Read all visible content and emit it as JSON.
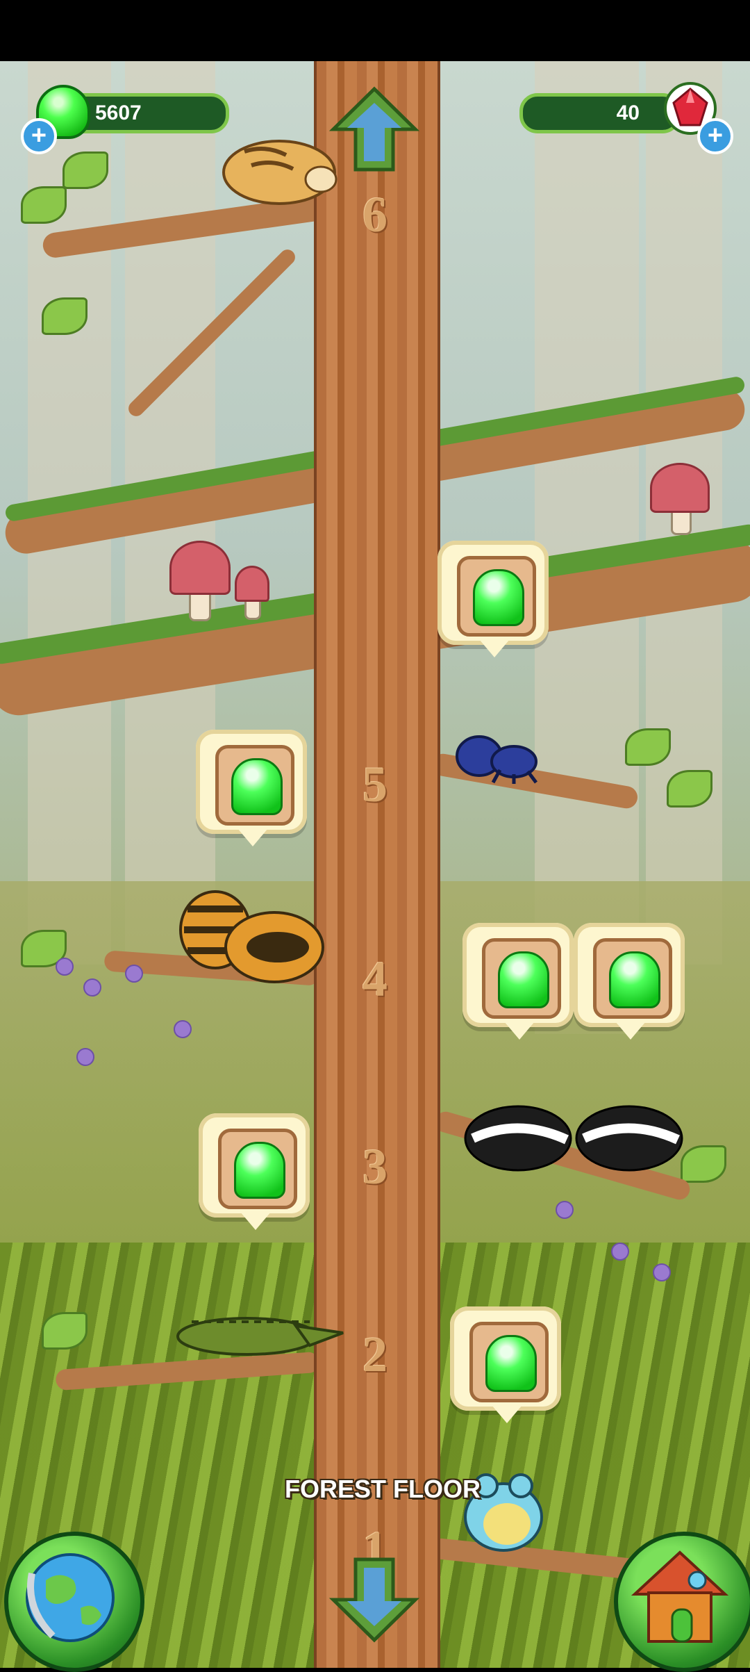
{
  "hud": {
    "jelly_count": "5607",
    "gem_count": "40",
    "add_jelly_label": "+",
    "add_gem_label": "+"
  },
  "tree": {
    "level_numbers": [
      "6",
      "5",
      "4",
      "3",
      "2",
      "1"
    ],
    "floor_label": "FOREST FLOOR"
  },
  "colors": {
    "jelly_green": "#2fe33a",
    "trunk_brown": "#b9713f",
    "hud_green": "#1e5a25"
  },
  "icons": {
    "up_arrow": "up-arrow-icon",
    "down_arrow": "down-arrow-icon",
    "globe": "globe-icon",
    "house": "house-icon",
    "gem": "ruby-gem-icon",
    "jelly": "green-jelly-icon"
  }
}
